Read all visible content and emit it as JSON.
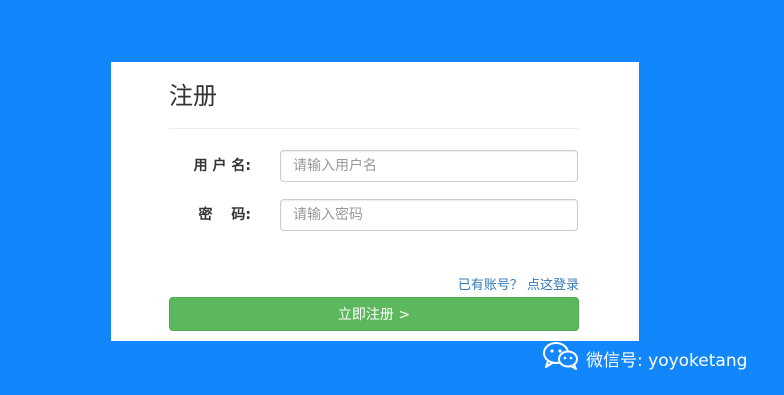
{
  "form": {
    "title": "注册",
    "username_label": "用 户 名:",
    "username_placeholder": "请输入用户名",
    "password_label": "密　 码:",
    "password_placeholder": "请输入密码",
    "login_link": "已有账号？ 点这登录",
    "submit_label": "立即注册 >"
  },
  "watermark": {
    "text": "微信号: yoyoketang",
    "icon": "wechat-icon"
  },
  "colors": {
    "background": "#1287fb",
    "button": "#5cb85c",
    "link": "#337ab7"
  }
}
